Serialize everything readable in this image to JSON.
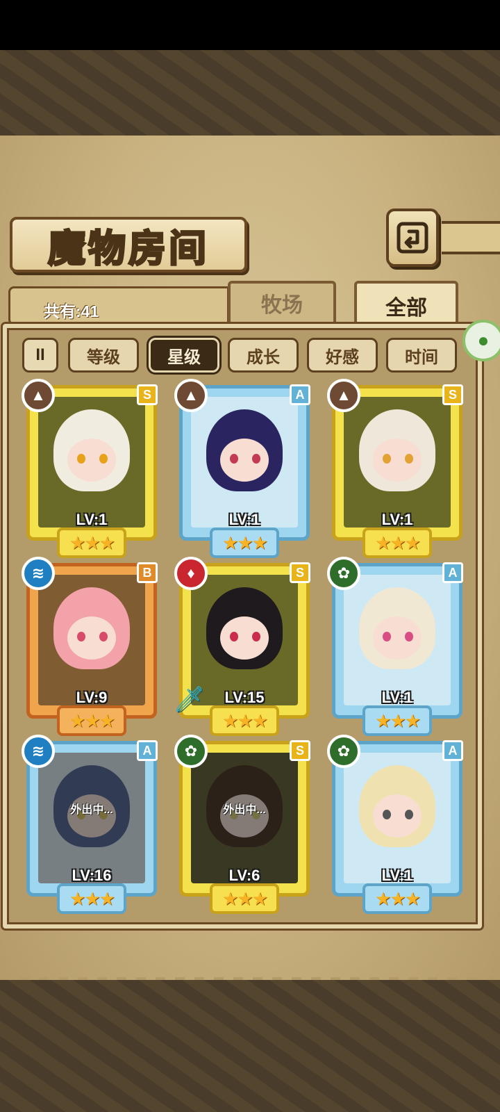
{
  "screen": {
    "title": "魔物房间",
    "count_label": "共有:41"
  },
  "tabs": [
    {
      "label": "牧场",
      "selected": false
    },
    {
      "label": "全部",
      "selected": true
    }
  ],
  "sort": {
    "toggle_icon": "II",
    "options": [
      {
        "label": "等级",
        "active": false
      },
      {
        "label": "星级",
        "active": true
      },
      {
        "label": "成长",
        "active": false
      },
      {
        "label": "好感",
        "active": false
      },
      {
        "label": "时间",
        "active": false
      }
    ]
  },
  "monsters": [
    {
      "grade": "S",
      "element": "earth",
      "element_icon": "▲",
      "level": "LV:1",
      "stars": "★★★",
      "frame": "gold",
      "hair": "#f1ece0",
      "eye": "#e8a11a",
      "away": ""
    },
    {
      "grade": "A",
      "element": "earth",
      "element_icon": "▲",
      "level": "LV:1",
      "stars": "★★★",
      "frame": "blue",
      "hair": "#2a2560",
      "eye": "#c23a55",
      "away": ""
    },
    {
      "grade": "S",
      "element": "earth",
      "element_icon": "▲",
      "level": "LV:1",
      "stars": "★★★",
      "frame": "gold",
      "hair": "#efe7da",
      "eye": "#e3a231",
      "away": ""
    },
    {
      "grade": "B",
      "element": "water",
      "element_icon": "≋",
      "level": "LV:9",
      "stars": "★★★",
      "frame": "orange",
      "hair": "#f2a2a8",
      "eye": "#d84b6a",
      "away": ""
    },
    {
      "grade": "S",
      "element": "fire",
      "element_icon": "♦",
      "level": "LV:15",
      "stars": "★★★",
      "frame": "gold",
      "hair": "#1f1a1d",
      "eye": "#c92d4b",
      "away": ""
    },
    {
      "grade": "A",
      "element": "wood",
      "element_icon": "✿",
      "level": "LV:1",
      "stars": "★★★",
      "frame": "blue",
      "hair": "#f1e8d4",
      "eye": "#d84d83",
      "away": ""
    },
    {
      "grade": "A",
      "element": "water",
      "element_icon": "≋",
      "level": "LV:16",
      "stars": "★★★",
      "frame": "blue",
      "hair": "#4e6db8",
      "eye": "#e8c42a",
      "away": "外出中..."
    },
    {
      "grade": "S",
      "element": "wood",
      "element_icon": "✿",
      "level": "LV:6",
      "stars": "★★★",
      "frame": "gold",
      "hair": "#5a3a22",
      "eye": "#d7d04a",
      "away": "外出中..."
    },
    {
      "grade": "A",
      "element": "wood",
      "element_icon": "✿",
      "level": "LV:1",
      "stars": "★★★",
      "frame": "blue",
      "hair": "#efe2b0",
      "eye": "#555555",
      "away": ""
    }
  ],
  "colors": {
    "earth": "#6e4a35",
    "water": "#1f7fc0",
    "fire": "#c9262f",
    "wood": "#2f6e2a"
  }
}
